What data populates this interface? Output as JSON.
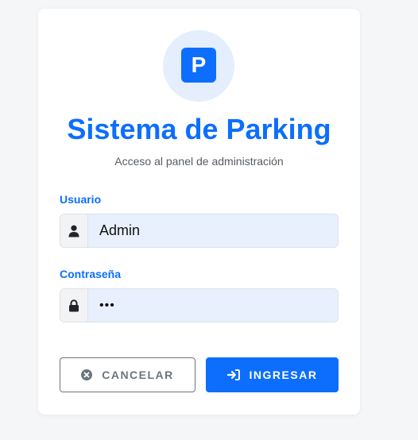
{
  "app": {
    "logo_letter": "P",
    "title": "Sistema de Parking",
    "subtitle": "Acceso al panel de administración"
  },
  "form": {
    "username": {
      "label": "Usuario",
      "value": "Admin",
      "icon": "user-icon"
    },
    "password": {
      "label": "Contraseña",
      "value": "•••",
      "icon": "lock-icon"
    }
  },
  "actions": {
    "cancel_label": "CANCELAR",
    "cancel_icon": "close-circle-icon",
    "login_label": "INGRESAR",
    "login_icon": "sign-in-icon"
  },
  "colors": {
    "primary": "#0d6efd",
    "secondary": "#6c757d",
    "input_bg": "#e8f0fe",
    "logo_bg": "#e4eefc"
  }
}
